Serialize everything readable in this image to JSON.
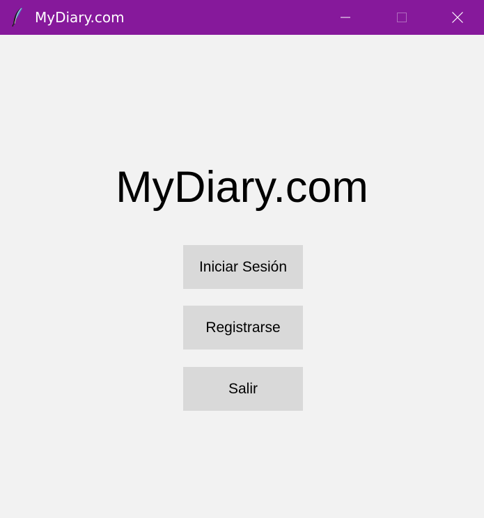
{
  "window": {
    "title": "MyDiary.com",
    "titlebar_color": "#86199b",
    "icon": "feather-icon",
    "controls": {
      "minimize_icon": "minimize-icon",
      "maximize_icon": "maximize-icon",
      "close_icon": "close-icon"
    }
  },
  "main": {
    "heading": "MyDiary.com",
    "background_color": "#f2f2f2",
    "buttons": [
      {
        "label": "Iniciar Sesión"
      },
      {
        "label": "Registrarse"
      },
      {
        "label": "Salir"
      }
    ],
    "button_color": "#d9d9d9"
  }
}
